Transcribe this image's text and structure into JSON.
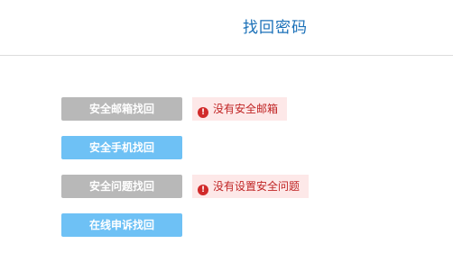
{
  "header": {
    "title": "找回密码"
  },
  "options": [
    {
      "label": "安全邮箱找回",
      "state": "disabled",
      "notice": "没有安全邮箱"
    },
    {
      "label": "安全手机找回",
      "state": "enabled"
    },
    {
      "label": "安全问题找回",
      "state": "disabled",
      "notice": "没有设置安全问题"
    },
    {
      "label": "在线申诉找回",
      "state": "enabled"
    }
  ],
  "icons": {
    "notice": "exclamation-circle-icon",
    "notice_glyph": "!"
  },
  "colors": {
    "title": "#1a70b8",
    "button_enabled": "#6ec1f5",
    "button_disabled": "#b8b8b8",
    "notice_bg": "#fde8e8",
    "notice_text": "#c02424",
    "notice_icon": "#d12a2a"
  }
}
